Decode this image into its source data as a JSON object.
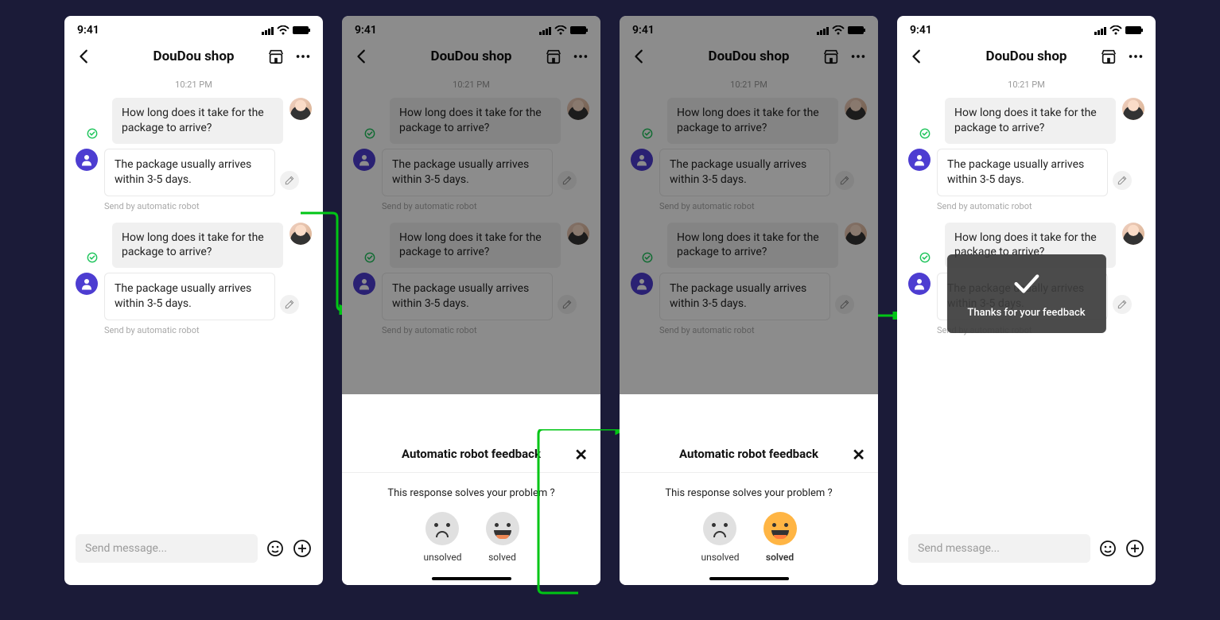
{
  "statusbar": {
    "time": "9:41"
  },
  "header": {
    "title": "DouDou shop"
  },
  "chat": {
    "timestamp": "10:21 PM",
    "user_q": "How long does it take for the package to arrive?",
    "bot_a": "The package usually arrives within 3-5 days.",
    "subnote": "Send by automatic robot"
  },
  "input": {
    "placeholder": "Send message..."
  },
  "sheet": {
    "title": "Automatic robot feedback",
    "question": "This response solves your problem ?",
    "opt_unsolved": "unsolved",
    "opt_solved": "solved"
  },
  "toast": {
    "text": "Thanks for your feedback"
  }
}
